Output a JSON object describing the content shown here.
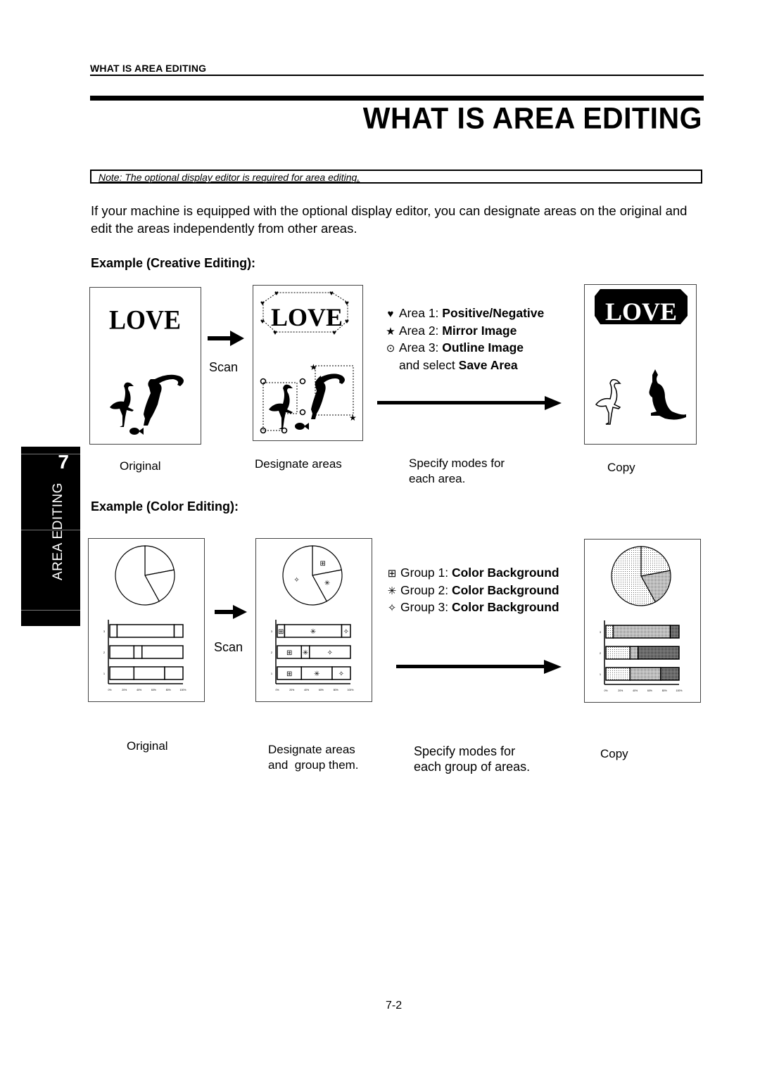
{
  "header": {
    "running_head": "WHAT IS AREA EDITING",
    "title": "WHAT IS AREA EDITING"
  },
  "note": "Note: The optional display editor is required for area editing.",
  "intro": "If your machine is equipped with the optional display editor, you can designate areas on the original and edit the areas independently from other areas.",
  "side_tab": {
    "chapter": "7",
    "label": "AREA EDITING"
  },
  "creative_example": {
    "heading": "Example (Creative Editing):",
    "image_text": "LOVE",
    "scan_label": "Scan",
    "legend": [
      {
        "icon": "heart-icon",
        "symbol": "♥",
        "prefix": "Area 1: ",
        "mode": "Positive/Negative"
      },
      {
        "icon": "star-icon",
        "symbol": "★",
        "prefix": "Area 2: ",
        "mode": "Mirror Image"
      },
      {
        "icon": "circle-dot-icon",
        "symbol": "⊙",
        "prefix": "Area 3: ",
        "mode": "Outline Image"
      }
    ],
    "legend_extra_prefix": "and select ",
    "legend_extra_mode": "Save Area",
    "captions": {
      "original": "Original",
      "designate": "Designate areas",
      "specify_line1": "Specify modes for",
      "specify_line2": "each area.",
      "copy": "Copy"
    }
  },
  "color_example": {
    "heading": "Example (Color Editing):",
    "scan_label": "Scan",
    "legend": [
      {
        "icon": "cross-box-icon",
        "symbol": "⊞",
        "prefix": "Group 1: ",
        "mode": "Color Background"
      },
      {
        "icon": "asterisk-icon",
        "symbol": "✳",
        "prefix": "Group 2: ",
        "mode": "Color Background"
      },
      {
        "icon": "diamond-star-icon",
        "symbol": "✧",
        "prefix": "Group 3: ",
        "mode": "Color Background"
      }
    ],
    "captions": {
      "original": "Original",
      "designate_line1": "Designate areas",
      "designate_line2": "and  group them.",
      "specify_line1": "Specify modes for",
      "specify_line2": "each group of areas.",
      "copy": "Copy"
    },
    "bar_rows": [
      "3",
      "2",
      "1"
    ],
    "axis_ticks": [
      "0%",
      "20%",
      "40%",
      "60%",
      "80%",
      "100%"
    ],
    "bar_segments": [
      [
        10,
        88,
        100
      ],
      [
        33,
        44,
        100
      ],
      [
        33,
        75,
        100
      ]
    ],
    "pie_slices_pct": [
      22,
      20,
      58
    ]
  },
  "footer": {
    "page_number": "7-2"
  }
}
